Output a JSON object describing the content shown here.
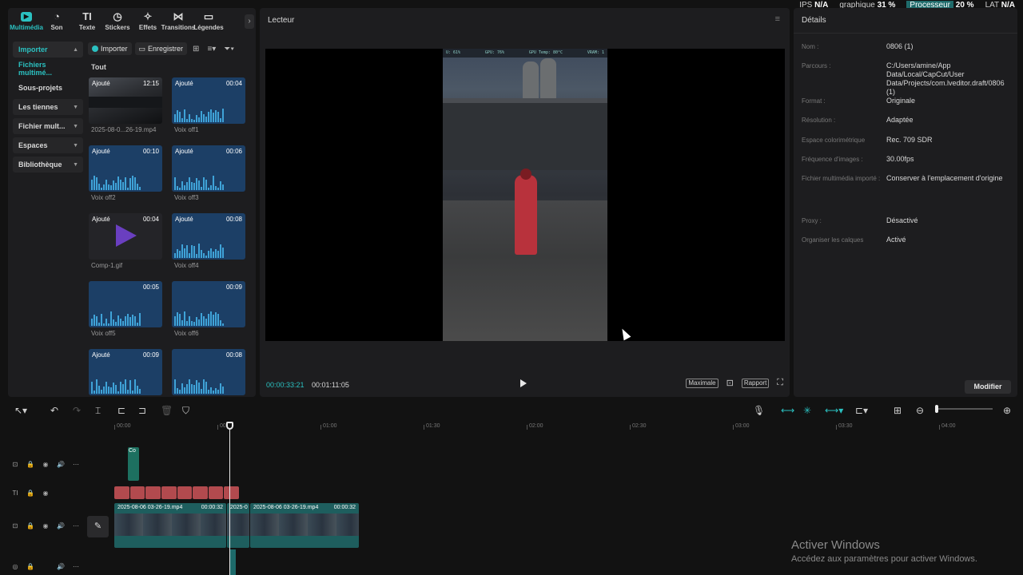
{
  "perf": {
    "ips_label": "IPS",
    "ips_value": "N/A",
    "gpu_label": "graphique",
    "gpu_value": "31 %",
    "cpu_label": "Processeur",
    "cpu_value": "20 %",
    "lat_label": "LAT",
    "lat_value": "N/A"
  },
  "media": {
    "tabs": [
      {
        "label": "Multimédia",
        "icon": "media-icon"
      },
      {
        "label": "Son",
        "icon": "audio-icon"
      },
      {
        "label": "Texte",
        "icon": "text-icon"
      },
      {
        "label": "Stickers",
        "icon": "sticker-icon"
      },
      {
        "label": "Effets",
        "icon": "effects-icon"
      },
      {
        "label": "Transitions",
        "icon": "transitions-icon"
      },
      {
        "label": "Légendes",
        "icon": "captions-icon"
      }
    ],
    "nav": [
      {
        "label": "Importer"
      },
      {
        "label": "Fichiers multimé..."
      },
      {
        "label": "Sous-projets"
      },
      {
        "label": "Les tiennes"
      },
      {
        "label": "Fichier mult..."
      },
      {
        "label": "Espaces"
      },
      {
        "label": "Bibliothèque"
      }
    ],
    "toolbar": {
      "import": "Importer",
      "record": "Enregistrer"
    },
    "all_label": "Tout",
    "clips": [
      {
        "badge": "Ajouté",
        "duration": "12:15",
        "name": "2025-08-0...26-19.mp4",
        "kind": "video"
      },
      {
        "badge": "Ajouté",
        "duration": "00:04",
        "name": "Voix off1",
        "kind": "audio"
      },
      {
        "badge": "Ajouté",
        "duration": "00:10",
        "name": "Voix off2",
        "kind": "audio"
      },
      {
        "badge": "Ajouté",
        "duration": "00:06",
        "name": "Voix off3",
        "kind": "audio"
      },
      {
        "badge": "Ajouté",
        "duration": "00:04",
        "name": "Comp-1.gif",
        "kind": "gif"
      },
      {
        "badge": "Ajouté",
        "duration": "00:08",
        "name": "Voix off4",
        "kind": "audio"
      },
      {
        "badge": "",
        "duration": "00:05",
        "name": "Voix off5",
        "kind": "audio"
      },
      {
        "badge": "",
        "duration": "00:09",
        "name": "Voix off6",
        "kind": "audio"
      },
      {
        "badge": "Ajouté",
        "duration": "00:09",
        "name": "",
        "kind": "audio"
      },
      {
        "badge": "",
        "duration": "00:08",
        "name": "",
        "kind": "audio"
      }
    ]
  },
  "player": {
    "title": "Lecteur",
    "hud": [
      "U: 61%",
      "GPU: 76%",
      "GPU Temp: 80°C",
      "VRAM: 1"
    ],
    "time_current": "00:00:33:21",
    "time_total": "00:01:11:05",
    "btn_max": "Maximale",
    "btn_ratio": "Rapport"
  },
  "details": {
    "title": "Détails",
    "rows": [
      {
        "k": "Nom :",
        "v": "0806 (1)"
      },
      {
        "k": "Parcours :",
        "v": "C:/Users/amine/App Data/Local/CapCut/User Data/Projects/com.lveditor.draft/0806 (1)"
      },
      {
        "k": "Format :",
        "v": "Originale"
      },
      {
        "k": "Résolution :",
        "v": "Adaptée"
      },
      {
        "k": "Espace colorimétrique",
        "v": "Rec. 709 SDR"
      },
      {
        "k": "Fréquence d'images :",
        "v": "30.00fps"
      },
      {
        "k": "Fichier multimédia importé :",
        "v": "Conserver à l'emplacement d'origine"
      },
      {
        "k": "Proxy :",
        "v": "Désactivé"
      },
      {
        "k": "Organiser les calques",
        "v": "Activé"
      }
    ],
    "modify": "Modifier"
  },
  "timeline": {
    "ticks": [
      "00:00",
      "00:30",
      "01:00",
      "01:30",
      "02:00",
      "02:30",
      "03:00",
      "03:30",
      "04:00"
    ],
    "gif_clip_label": "Co",
    "video_clips": [
      {
        "name": "2025-08-06 03-26-19.mp4",
        "len": "00:00:32"
      },
      {
        "name": "2025-0",
        "len": ""
      },
      {
        "name": "2025-08-06 03-26-19.mp4",
        "len": "00:00:32"
      }
    ]
  },
  "watermark": {
    "title": "Activer Windows",
    "sub": "Accédez aux paramètres pour activer Windows."
  },
  "colors": {
    "accent": "#2bc1c1",
    "audio_clip": "#1c3f66",
    "text_clip": "#b24a4e",
    "video_clip": "#1e5e5e"
  }
}
